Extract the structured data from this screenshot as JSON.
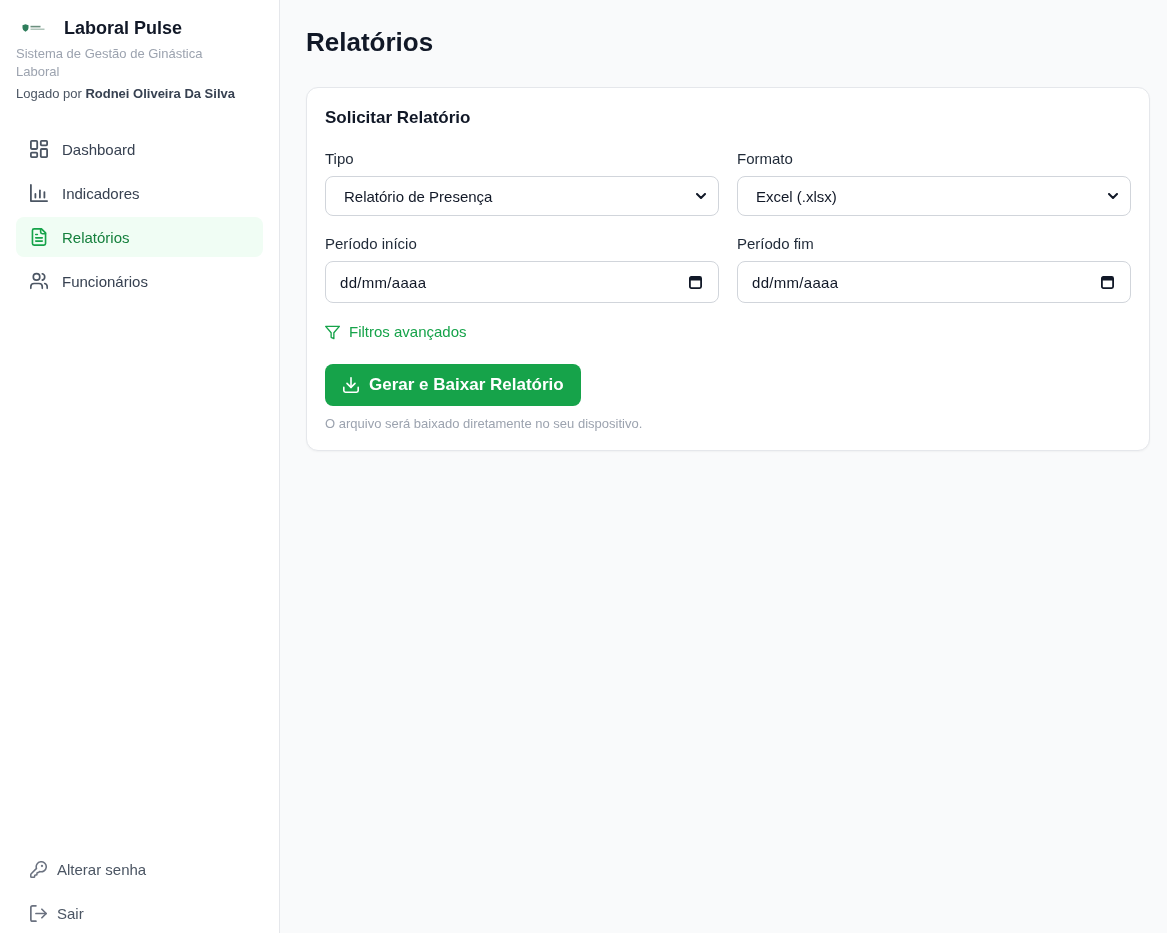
{
  "sidebar": {
    "app_name": "Laboral Pulse",
    "subtitle": "Sistema de Gestão de Ginástica Laboral",
    "logged_in": "Logado por **Rodnei Oliveira Da Silva**",
    "nav": [
      {
        "label": "Dashboard",
        "selected": false
      },
      {
        "label": "Indicadores",
        "selected": false
      },
      {
        "label": "Relatórios",
        "selected": true
      },
      {
        "label": "Funcionários",
        "selected": false
      }
    ],
    "footer": [
      {
        "label": "Alterar senha"
      },
      {
        "label": "Sair"
      }
    ]
  },
  "page": {
    "title": "Relatórios"
  },
  "form": {
    "title": "Solicitar Relatório",
    "fields": [
      {
        "kind": "select",
        "label": "Tipo",
        "value": "Relatório de Presença"
      },
      {
        "kind": "select",
        "label": "Formato",
        "value": "Excel (.xlsx)"
      },
      {
        "kind": "date",
        "label": "Período início",
        "placeholder": "dd/mm/aaaa"
      },
      {
        "kind": "date",
        "label": "Período fim",
        "placeholder": "dd/mm/aaaa"
      }
    ],
    "filters_link": "Filtros avançados",
    "submit": "Gerar e Baixar Relatório",
    "note": "O arquivo será baixado diretamente no seu dispositivo."
  }
}
